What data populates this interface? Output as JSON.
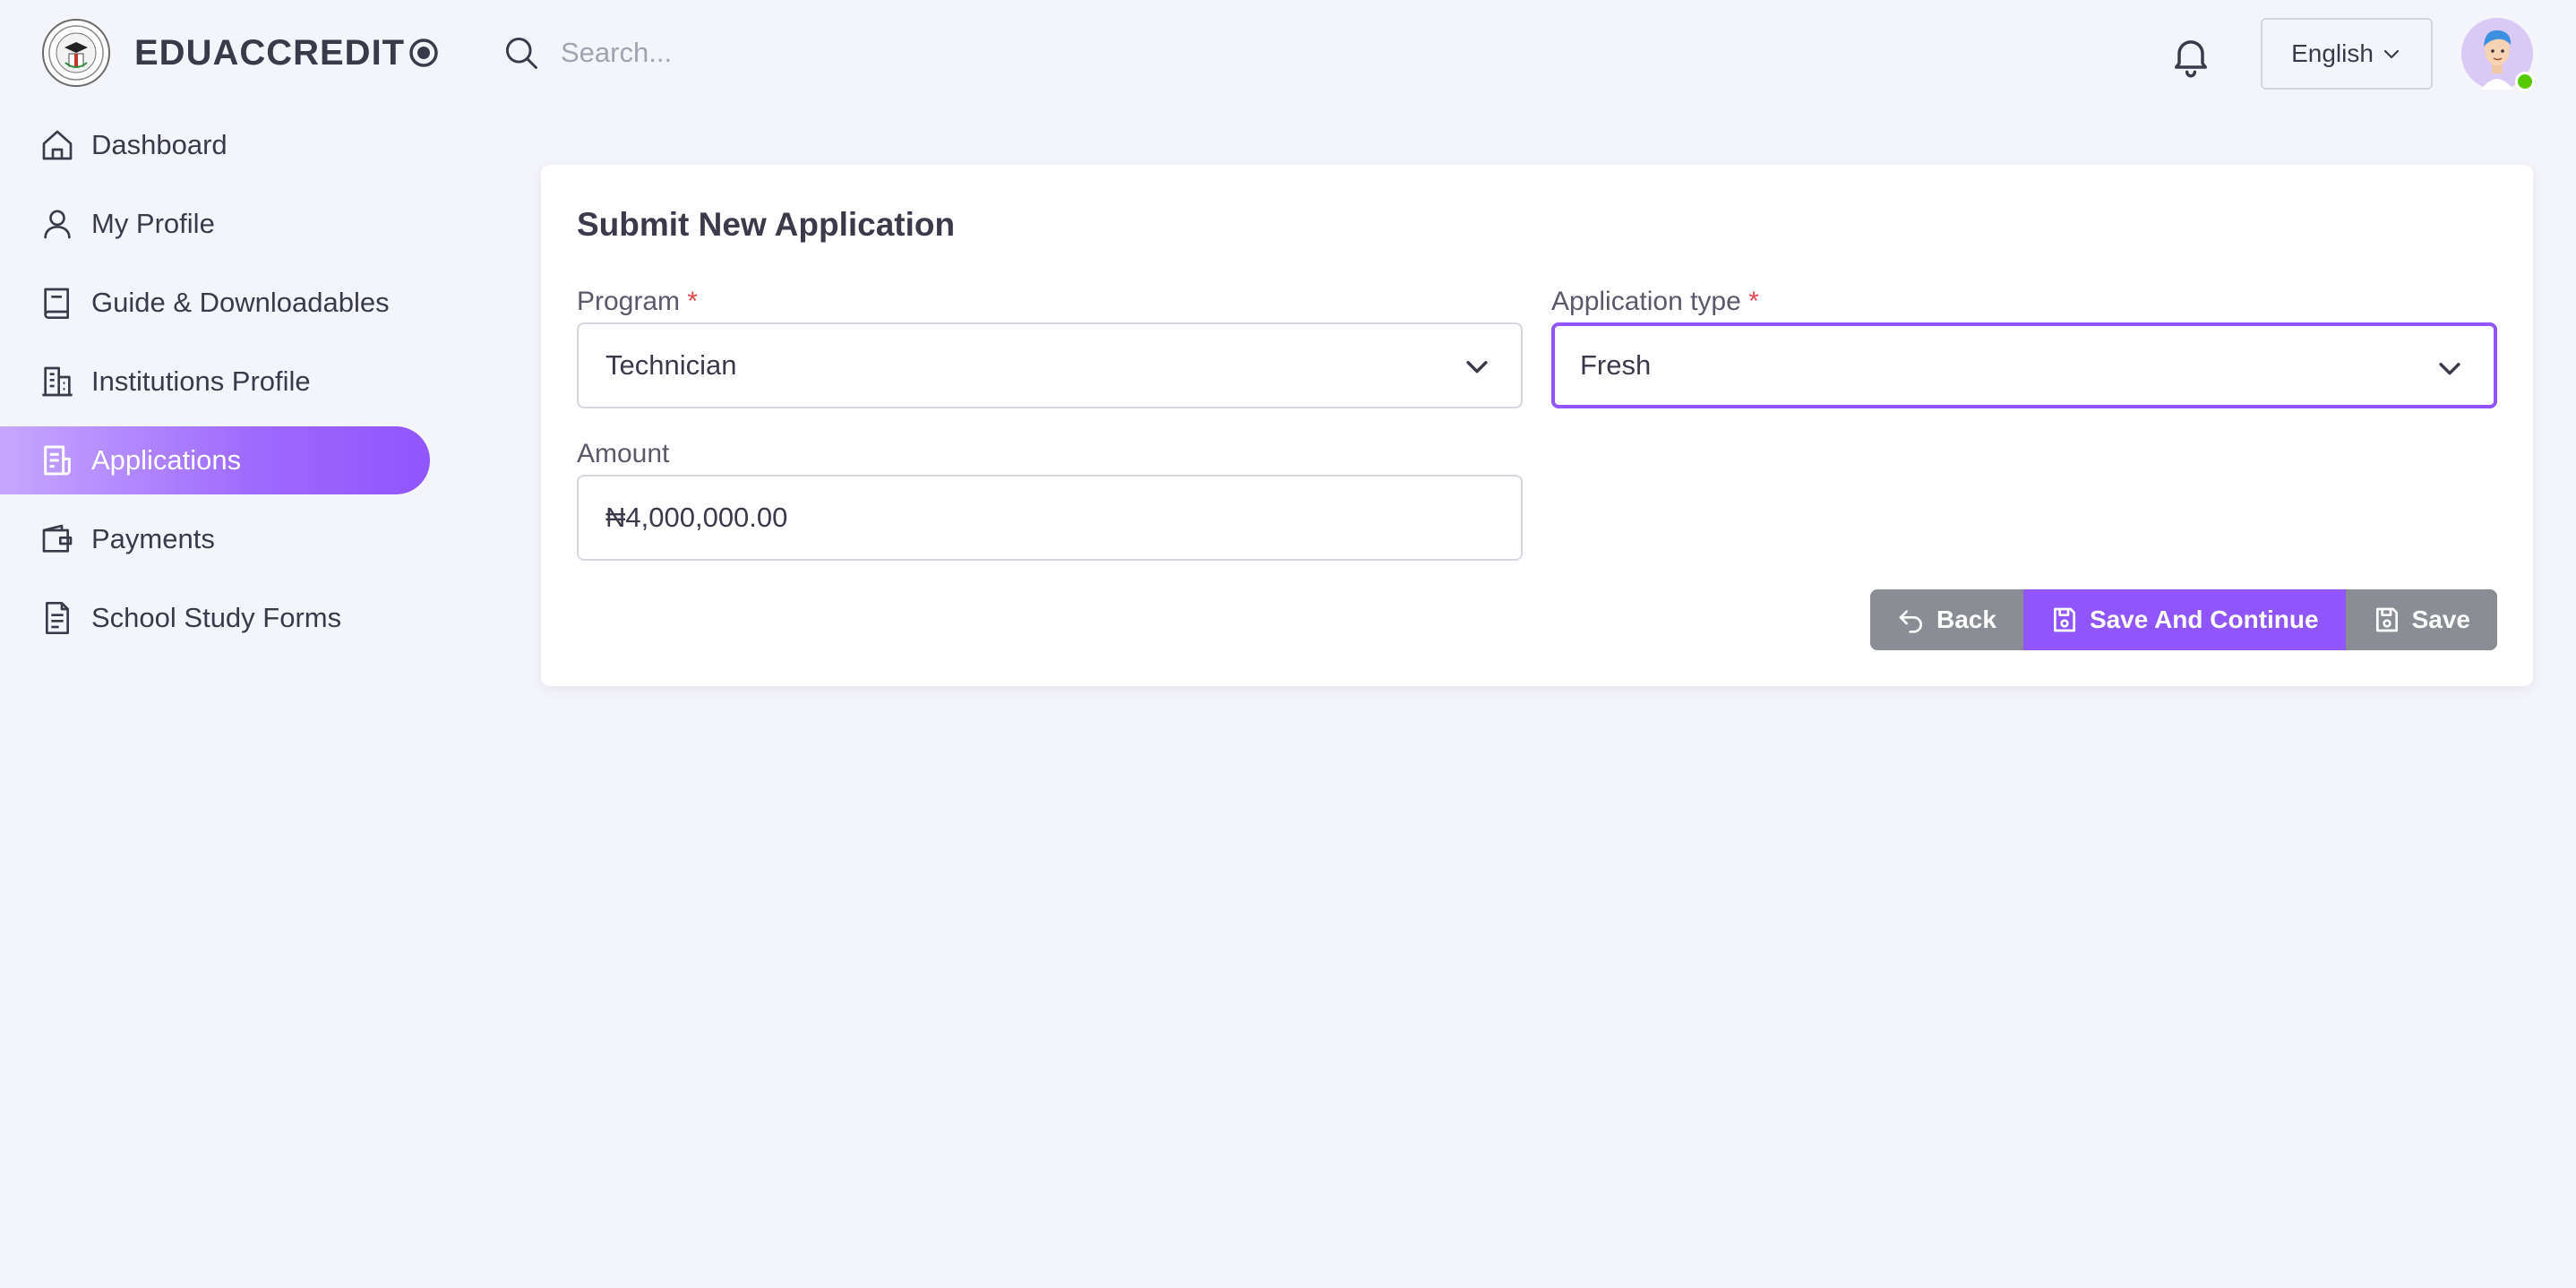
{
  "brand": {
    "name": "EDUACCREDIT"
  },
  "search": {
    "placeholder": "Search..."
  },
  "language": {
    "selected": "English"
  },
  "sidebar": {
    "items": [
      {
        "label": "Dashboard",
        "icon": "home-icon"
      },
      {
        "label": "My Profile",
        "icon": "user-icon"
      },
      {
        "label": "Guide & Downloadables",
        "icon": "book-icon"
      },
      {
        "label": "Institutions Profile",
        "icon": "building-icon"
      },
      {
        "label": "Applications",
        "icon": "document-list-icon",
        "active": true
      },
      {
        "label": "Payments",
        "icon": "wallet-icon"
      },
      {
        "label": "School Study Forms",
        "icon": "file-text-icon"
      }
    ]
  },
  "form": {
    "title": "Submit New Application",
    "program": {
      "label": "Program",
      "required_mark": "*",
      "value": "Technician"
    },
    "application_type": {
      "label": "Application type",
      "required_mark": "*",
      "value": "Fresh"
    },
    "amount": {
      "label": "Amount",
      "value": "₦4,000,000.00"
    },
    "buttons": {
      "back": "Back",
      "save_continue": "Save And Continue",
      "save": "Save"
    }
  },
  "colors": {
    "accent": "#9155fd",
    "secondary_button": "#8a8d93",
    "background": "#f4f5fa",
    "online": "#56ca00"
  }
}
